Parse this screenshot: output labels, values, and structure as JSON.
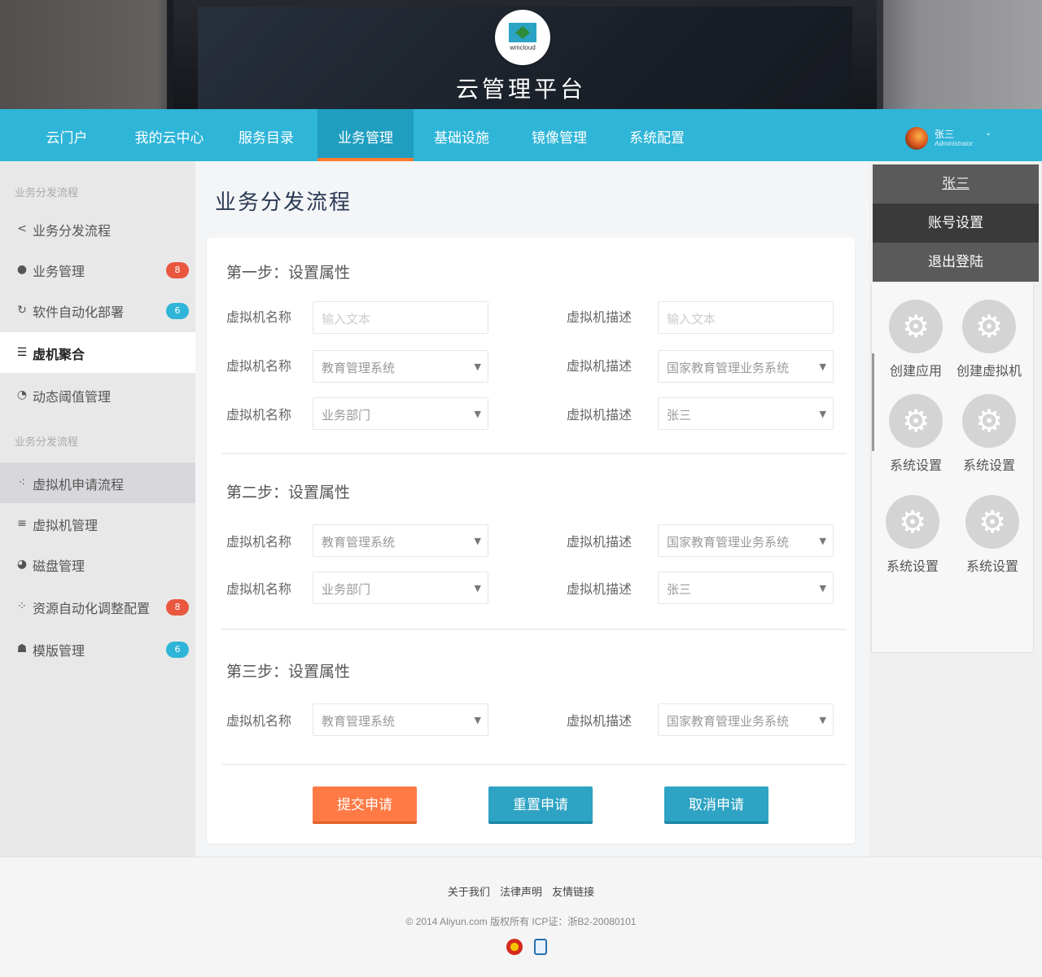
{
  "brand": {
    "logo_text": "wmcloud",
    "title": "云管理平台"
  },
  "nav": {
    "items": [
      {
        "label": "云门户"
      },
      {
        "label": "我的云中心"
      },
      {
        "label": "服务目录"
      },
      {
        "label": "业务管理",
        "active": true
      },
      {
        "label": "基础设施"
      },
      {
        "label": "镜像管理"
      },
      {
        "label": "系统配置"
      }
    ],
    "user": {
      "name": "张三",
      "role": "Administrator"
    }
  },
  "sidebar": {
    "section1": "业务分发流程",
    "section2": "业务分发流程",
    "items": [
      {
        "label": "业务分发流程",
        "icon": "share-icon"
      },
      {
        "label": "业务管理",
        "icon": "user-icon",
        "badge": "8",
        "badge_color": "#e9573f"
      },
      {
        "label": "软件自动化部署",
        "icon": "refresh-icon",
        "badge": "6",
        "badge_color": "#2eb5d8"
      },
      {
        "label": "虚机聚合",
        "icon": "list-icon",
        "active": true
      },
      {
        "label": "动态阈值管理",
        "icon": "threshold-icon"
      },
      {
        "label": "虚拟机申请流程",
        "icon": "flow-icon",
        "selected": true
      },
      {
        "label": "虚拟机管理",
        "icon": "server-icon"
      },
      {
        "label": "磁盘管理",
        "icon": "disk-icon"
      },
      {
        "label": "资源自动化调整配置",
        "icon": "resource-icon",
        "badge": "8",
        "badge_color": "#e9573f"
      },
      {
        "label": "模版管理",
        "icon": "template-icon",
        "badge": "6",
        "badge_color": "#2eb5d8"
      }
    ]
  },
  "main": {
    "title": "业务分发流程",
    "steps": [
      {
        "title": "第一步：设置属性",
        "rows": [
          {
            "left_label": "虚拟机名称",
            "left_value": "",
            "left_placeholder": "输入文本",
            "left_select": false,
            "right_label": "虚拟机描述",
            "right_value": "",
            "right_placeholder": "输入文本",
            "right_select": false
          },
          {
            "left_label": "虚拟机名称",
            "left_value": "教育管理系统",
            "left_select": true,
            "right_label": "虚拟机描述",
            "right_value": "国家教育管理业务系统",
            "right_select": true
          },
          {
            "left_label": "虚拟机名称",
            "left_value": "业务部门",
            "left_select": true,
            "right_label": "虚拟机描述",
            "right_value": "张三",
            "right_select": true
          }
        ]
      },
      {
        "title": "第二步：设置属性",
        "rows": [
          {
            "left_label": "虚拟机名称",
            "left_value": "教育管理系统",
            "left_select": true,
            "right_label": "虚拟机描述",
            "right_value": "国家教育管理业务系统",
            "right_select": true
          },
          {
            "left_label": "虚拟机名称",
            "left_value": "业务部门",
            "left_select": true,
            "right_label": "虚拟机描述",
            "right_value": "张三",
            "right_select": true
          }
        ]
      },
      {
        "title": "第三步：设置属性",
        "rows": [
          {
            "left_label": "虚拟机名称",
            "left_value": "教育管理系统",
            "left_select": true,
            "right_label": "虚拟机描述",
            "right_value": "国家教育管理业务系统",
            "right_select": true
          }
        ]
      }
    ],
    "buttons": {
      "submit": "提交申请",
      "reset": "重置申请",
      "cancel": "取消申请"
    }
  },
  "right_panel": {
    "user_name": "张三",
    "account_settings": "账号设置",
    "logout": "退出登陆",
    "apps": [
      {
        "label": "创建应用",
        "icon": "gear-icon"
      },
      {
        "label": "创建虚拟机",
        "icon": "gear-icon"
      },
      {
        "label": "系统设置",
        "icon": "gear-icon"
      },
      {
        "label": "系统设置",
        "icon": "gear-icon"
      },
      {
        "label": "系统设置",
        "icon": "gear-icon"
      },
      {
        "label": "系统设置",
        "icon": "gear-icon"
      }
    ]
  },
  "footer": {
    "links": [
      "关于我们",
      "法律声明",
      "友情链接"
    ],
    "copyright": "© 2014 Aliyun.com 版权所有 ICP证：浙B2-20080101"
  },
  "colors": {
    "primary": "#2eb5d8",
    "accent": "#ff7a45",
    "badge_red": "#e9573f"
  }
}
